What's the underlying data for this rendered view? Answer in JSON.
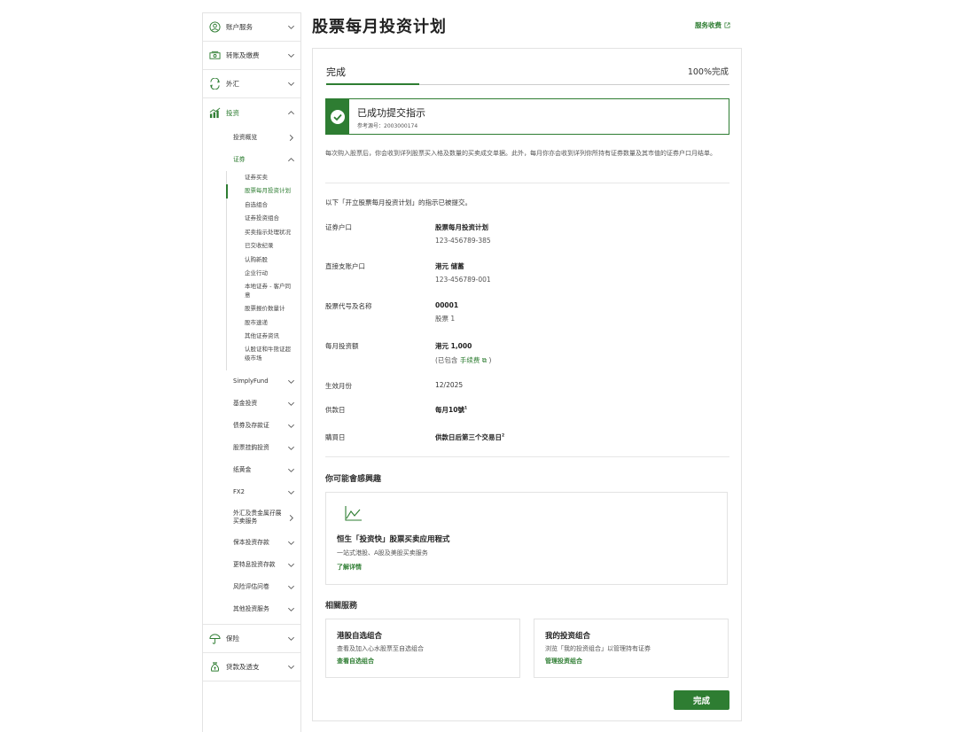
{
  "sidebar": {
    "top_items": [
      {
        "label": "账户服务",
        "icon": "user-circle-icon"
      },
      {
        "label": "转账及缴费",
        "icon": "money-transfer-icon"
      },
      {
        "label": "外汇",
        "icon": "currency-exchange-icon"
      },
      {
        "label": "投资",
        "icon": "investment-chart-icon"
      }
    ],
    "invest_sub": [
      {
        "label": "投资概览"
      },
      {
        "label": "证券"
      }
    ],
    "securities_sub": [
      {
        "label": "证券买卖"
      },
      {
        "label": "股票每月投资计划"
      },
      {
        "label": "自选组合"
      },
      {
        "label": "证券投资组合"
      },
      {
        "label": "买卖指示处理状况"
      },
      {
        "label": "已交收纪录"
      },
      {
        "label": "认购新股"
      },
      {
        "label": "企业行动"
      },
      {
        "label": "本地证券 - 客户同意"
      },
      {
        "label": "股票报价数量计"
      },
      {
        "label": "股市速递"
      },
      {
        "label": "其他证券资讯"
      },
      {
        "label": "认股证和牛熊证超级市场"
      }
    ],
    "invest_sub_more": [
      {
        "label": "SimplyFund"
      },
      {
        "label": "基金投资"
      },
      {
        "label": "债券及存款证"
      },
      {
        "label": "股票挂鈎投资"
      },
      {
        "label": "纸黄金"
      },
      {
        "label": "FX2"
      },
      {
        "label": "外汇及贵金属孖展买卖服务"
      },
      {
        "label": "保本投资存款"
      },
      {
        "label": "更特息投资存款"
      },
      {
        "label": "风险评估问卷"
      },
      {
        "label": "其他投资服务"
      }
    ],
    "bottom_items": [
      {
        "label": "保险",
        "icon": "umbrella-icon"
      },
      {
        "label": "贷款及透支",
        "icon": "loan-bag-icon"
      }
    ]
  },
  "header": {
    "title": "股票每月投资计划",
    "fee_link": "服务收费"
  },
  "progress": {
    "step_label": "完成",
    "progress_text": "100%完成",
    "fraction": 0.23
  },
  "success": {
    "title": "已成功提交指示",
    "reference": "参考源号：2003000174"
  },
  "notice": "每次购入股票后，你会收到详列股票买入格及数量的买卖成交单据。此外，每月你亦会收到详列你所持有证券数量及其市值的证券户口月结单。",
  "intro": "以下「开立股票每月投资计划」的指示已被提交。",
  "details": {
    "account_label": "证券户口",
    "account_name": "股票每月投资计划",
    "account_no": "123-456789-385",
    "debit_label": "直接支账户口",
    "debit_name": "港元 储蓄",
    "debit_no": "123-456789-001",
    "stock_label": "股票代号及名称",
    "stock_code": "00001",
    "stock_name": "股票 1",
    "amount_label": "每月投资额",
    "amount_value": "港元 1,000",
    "amount_note_prefix": "(已包含",
    "amount_note_link": "手续费",
    "amount_note_suffix": ")",
    "effective_label": "生效月份",
    "effective_value": "12/2025",
    "debit_day_label": "供款日",
    "debit_day_value": "每月10號",
    "debit_day_sup": "1",
    "buy_day_label": "購買日",
    "buy_day_value": "供款日后第三个交易日",
    "buy_day_sup": "2"
  },
  "interest": {
    "heading": "你可能會感興趣",
    "title": "恒生「投资快」股票买卖应用程式",
    "desc": "一站式港股、A股及美股买卖服务",
    "link": "了解详情"
  },
  "related": {
    "heading": "相關服務",
    "cards": [
      {
        "title": "港股自选组合",
        "desc": "查看及加入心水股票至自选组合",
        "link": "查看自选组合"
      },
      {
        "title": "我的投资组合",
        "desc": "浏览「我的投资组合」以管理持有证券",
        "link": "管理投资组合"
      }
    ]
  },
  "done_button": "完成",
  "colors": {
    "brand": "#2e7d32"
  }
}
